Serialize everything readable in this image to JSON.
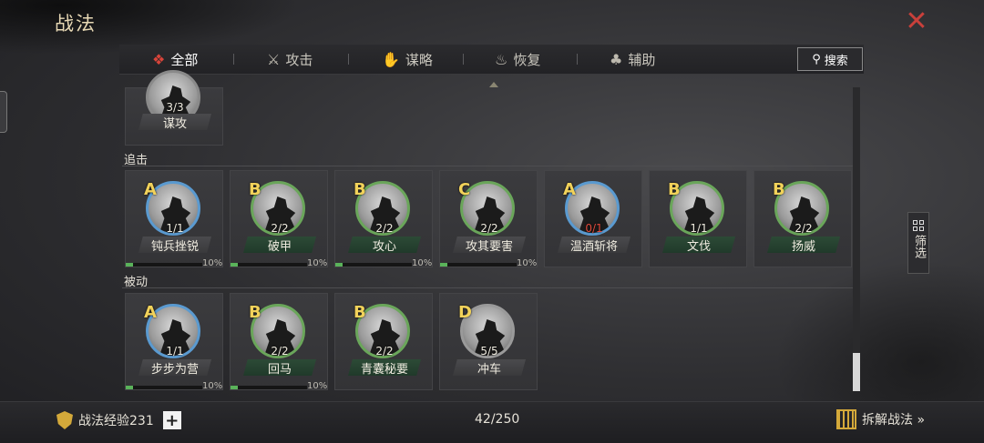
{
  "title": "战法",
  "tabs": [
    {
      "label": "全部",
      "icon": "scroll-icon",
      "active": true
    },
    {
      "label": "攻击",
      "icon": "crossed-swords-icon",
      "active": false
    },
    {
      "label": "谋略",
      "icon": "strategy-hand-icon",
      "active": false
    },
    {
      "label": "恢复",
      "icon": "heal-pot-icon",
      "active": false
    },
    {
      "label": "辅助",
      "icon": "support-bag-icon",
      "active": false
    }
  ],
  "search_label": "搜索",
  "partial_card": {
    "count": "3/3",
    "name": "谋攻"
  },
  "sections": [
    {
      "label": "追击",
      "cards": [
        {
          "grade": "A",
          "count": "1/1",
          "name": "钝兵挫锐",
          "progress": 0.1,
          "pct": "10%",
          "ribbon": "gray",
          "count_red": false
        },
        {
          "grade": "B",
          "count": "2/2",
          "name": "破甲",
          "progress": 0.1,
          "pct": "10%",
          "ribbon": "green",
          "count_red": false
        },
        {
          "grade": "B",
          "count": "2/2",
          "name": "攻心",
          "progress": 0.1,
          "pct": "10%",
          "ribbon": "green",
          "count_red": false
        },
        {
          "grade": "C",
          "count": "2/2",
          "name": "攻其要害",
          "progress": 0.1,
          "pct": "10%",
          "ribbon": "gray",
          "count_red": false
        },
        {
          "grade": "A",
          "count": "0/1",
          "name": "温酒斩将",
          "progress": 0,
          "pct": "",
          "ribbon": "gray",
          "count_red": true
        },
        {
          "grade": "B",
          "count": "1/1",
          "name": "文伐",
          "progress": 0,
          "pct": "",
          "ribbon": "green",
          "count_red": false
        },
        {
          "grade": "B",
          "count": "2/2",
          "name": "扬威",
          "progress": 0,
          "pct": "",
          "ribbon": "green",
          "count_red": false
        }
      ]
    },
    {
      "label": "被动",
      "cards": [
        {
          "grade": "A",
          "count": "1/1",
          "name": "步步为营",
          "progress": 0.1,
          "pct": "10%",
          "ribbon": "gray",
          "count_red": false
        },
        {
          "grade": "B",
          "count": "2/2",
          "name": "回马",
          "progress": 0.1,
          "pct": "10%",
          "ribbon": "green",
          "count_red": false
        },
        {
          "grade": "B",
          "count": "2/2",
          "name": "青囊秘要",
          "progress": 0,
          "pct": "",
          "ribbon": "green",
          "count_red": false
        },
        {
          "grade": "D",
          "count": "5/5",
          "name": "冲车",
          "progress": 0,
          "pct": "",
          "ribbon": "gray",
          "count_red": false
        }
      ]
    }
  ],
  "filter_label": "筛选",
  "footer": {
    "exp_label": "战法经验231",
    "slots": "42/250",
    "disassemble_label": "拆解战法 »"
  }
}
